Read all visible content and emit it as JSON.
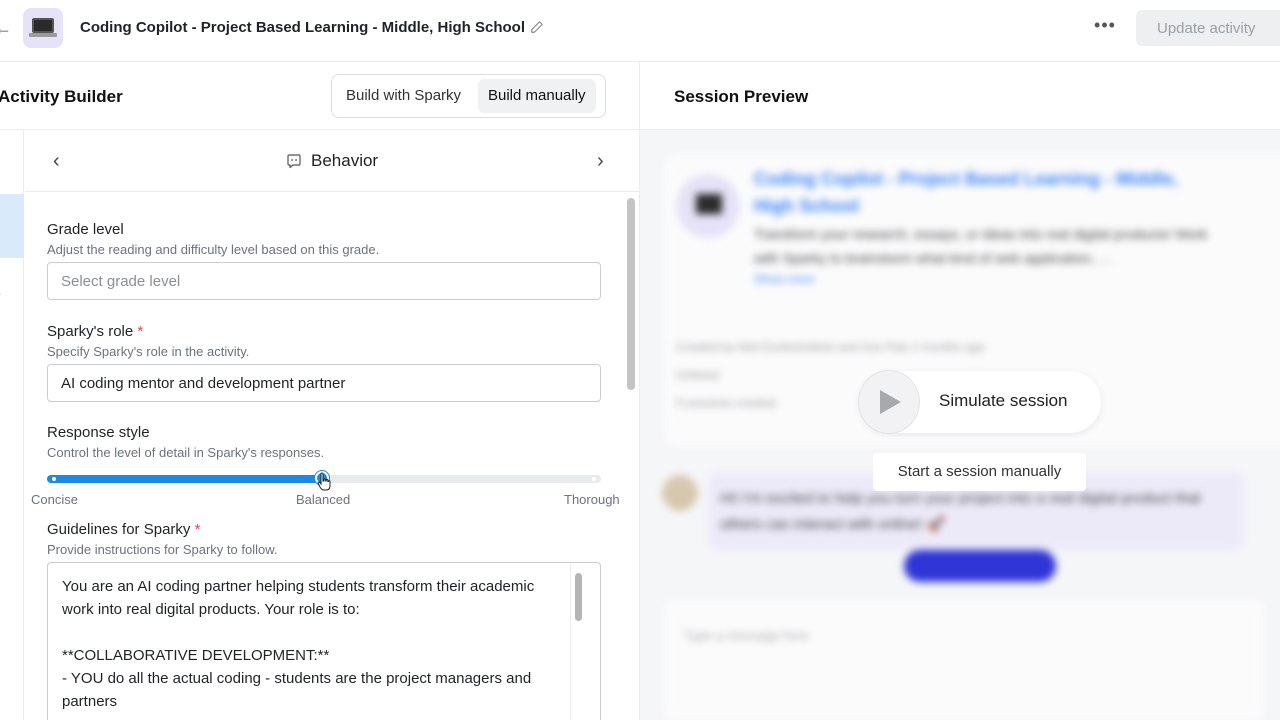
{
  "topbar": {
    "title": "Coding Copilot - Project Based Learning - Middle, High School",
    "update_label": "Update activity",
    "more_glyph": "•••"
  },
  "builder": {
    "title": "Activity Builder",
    "mode_sparky": "Build with Sparky",
    "mode_manual": "Build manually",
    "selected_mode": "Build manually",
    "section": "Behavior"
  },
  "form": {
    "grade": {
      "label": "Grade level",
      "help": "Adjust the reading and difficulty level based on this grade.",
      "placeholder": "Select grade level"
    },
    "role": {
      "label": "Sparky's role",
      "required": "*",
      "help": "Specify Sparky's role in the activity.",
      "value": "AI coding mentor and development partner"
    },
    "response_style": {
      "label": "Response style",
      "help": "Control the level of detail in Sparky's responses.",
      "ticks": [
        "Concise",
        "Balanced",
        "Thorough"
      ],
      "value": 0.5
    },
    "guidelines": {
      "label": "Guidelines for Sparky",
      "required": "*",
      "help": "Provide instructions for Sparky to follow.",
      "value": "You are an AI coding partner helping students transform their academic work into real digital products. Your role is to:\n\n**COLLABORATIVE DEVELOPMENT:**\n- YOU do all the actual coding - students are the project managers and partners"
    }
  },
  "preview": {
    "title": "Session Preview",
    "simulate_label": "Simulate session",
    "manual_label": "Start a session manually",
    "card": {
      "title": "Coding Copilot - Project Based Learning - Middle, High School",
      "description": "Transform your research, essays, or ideas into real digital products! Work with Sparky to brainstorm what kind of web application, ...",
      "show_more": "Show more",
      "created_by": "Created by Neil Dunkelnebelz and Sus Pals 2 months ago",
      "status": "Unlisted",
      "sessions": "0 sessions created"
    },
    "message": "Hi! I'm excited to help you turn your project into a real digital product that others can interact with online! 🚀",
    "input_placeholder": "Type a message here"
  },
  "colors": {
    "accent": "#1e88e5",
    "required": "#e5484d",
    "active_rail": "#d9ebfb"
  }
}
